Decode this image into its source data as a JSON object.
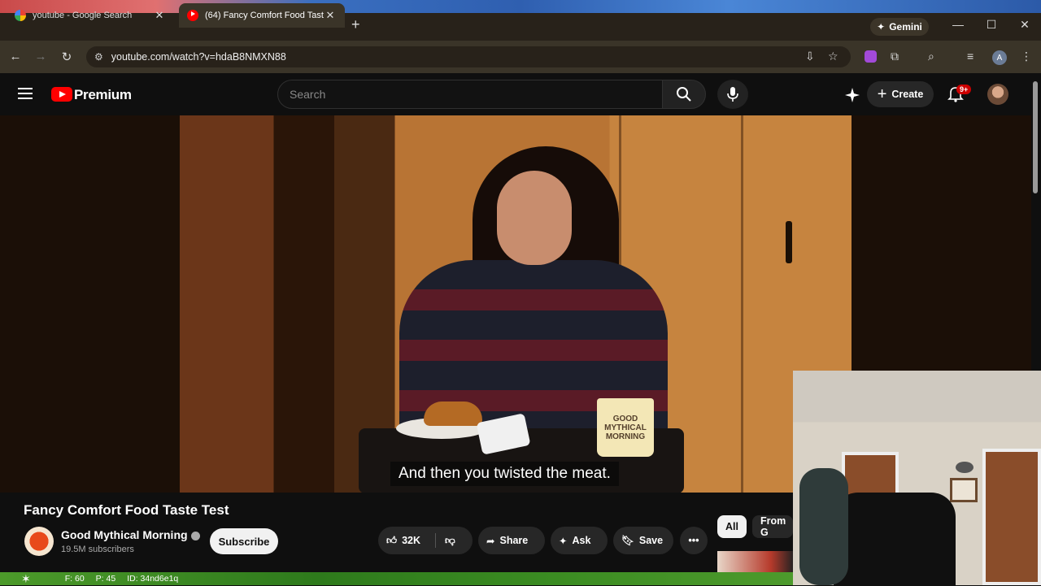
{
  "browser": {
    "tabs": [
      {
        "title": "youtube - Google Search",
        "active": false
      },
      {
        "title": "(64) Fancy Comfort Food Taste Test",
        "active": true
      }
    ],
    "gemini_label": "Gemini",
    "url": "youtube.com/watch?v=hdaB8NMXN88"
  },
  "youtube": {
    "brand": "Premium",
    "search_placeholder": "Search",
    "create_label": "Create",
    "notification_count": "9+",
    "caption": "And then you twisted the meat.",
    "mug_text": [
      "GOOD",
      "MYTHICAL",
      "MORNING"
    ],
    "video_title": "Fancy Comfort Food Taste Test",
    "channel_name": "Good Mythical Morning",
    "subscribers": "19.5M subscribers",
    "subscribe_label": "Subscribe",
    "like_count": "32K",
    "share_label": "Share",
    "ask_label": "Ask",
    "save_label": "Save",
    "chips": [
      "All",
      "From G"
    ]
  },
  "overlay_status": {
    "f": "F: 60",
    "p": "P: 45",
    "id": "ID: 34nd6e1q"
  },
  "colors": {
    "brand_red": "#ff0000",
    "background": "#0f0f0f",
    "chrome_frame": "#28221a"
  }
}
